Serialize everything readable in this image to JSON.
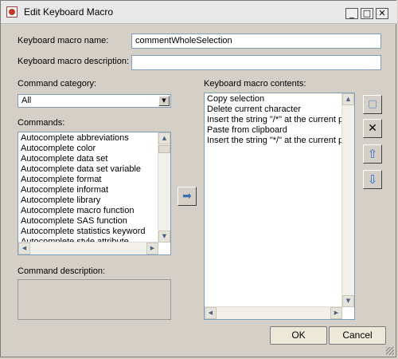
{
  "window": {
    "title": "Edit Keyboard Macro",
    "minimize_glyph": "_",
    "maximize_glyph": "□",
    "close_glyph": "✕"
  },
  "form": {
    "name_label": "Keyboard macro name:",
    "name_value": "commentWholeSelection",
    "description_label": "Keyboard macro description:",
    "description_value": "",
    "category_label": "Command category:",
    "category_value": "All",
    "commands_label": "Commands:",
    "commands": [
      "Autocomplete abbreviations",
      "Autocomplete color",
      "Autocomplete data set",
      "Autocomplete data set variable",
      "Autocomplete format",
      "Autocomplete informat",
      "Autocomplete library",
      "Autocomplete macro function",
      "Autocomplete SAS function",
      "Autocomplete statistics keyword",
      "Autocomplete style attribute"
    ],
    "command_description_label": "Command description:",
    "contents_label": "Keyboard macro contents:",
    "contents": [
      "Copy selection",
      "Delete current character",
      "Insert the string \"/*\" at the current p",
      "Paste from clipboard",
      "Insert the string \"*/\" at the current p"
    ]
  },
  "buttons": {
    "ok": "OK",
    "cancel": "Cancel"
  },
  "icons": {
    "add_arrow": "➡",
    "new_item": "▢",
    "delete": "✕",
    "move_up": "⇧",
    "move_down": "⇩",
    "scroll_up": "▲",
    "scroll_down": "▼",
    "scroll_left": "◀",
    "scroll_right": "▶",
    "combo_arrow": "▼"
  }
}
